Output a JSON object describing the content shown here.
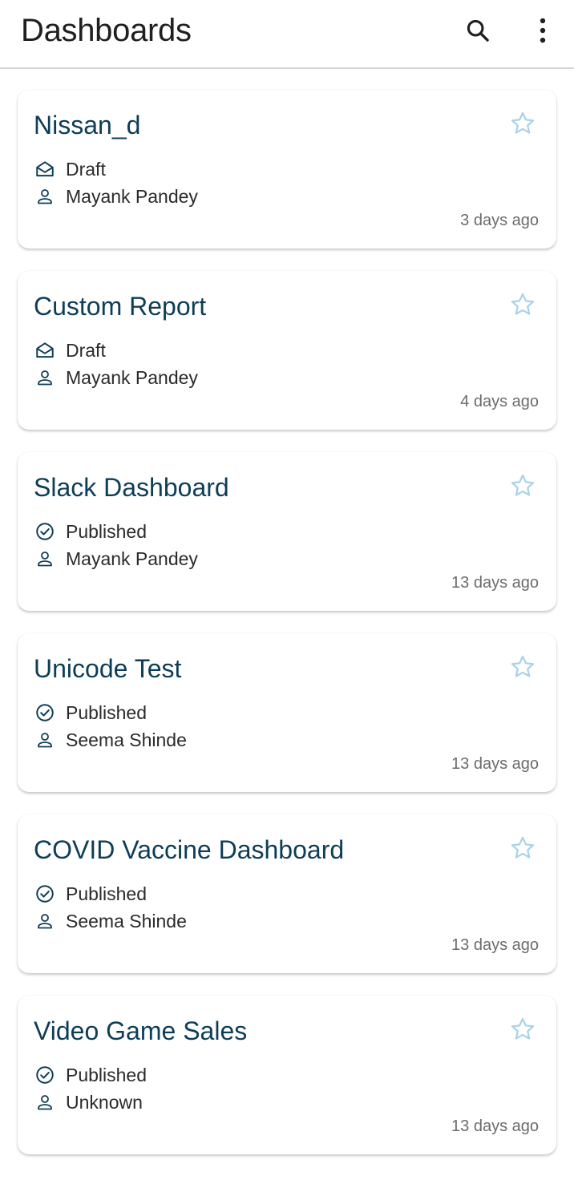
{
  "app_bar": {
    "title": "Dashboards",
    "search_icon": "search-icon",
    "more_icon": "more-vertical-icon"
  },
  "colors": {
    "title_text": "#0e3d57",
    "star_outline": "#a9d3ea",
    "meta_icon": "#0e3d57"
  },
  "dashboards": [
    {
      "title": "Nissan_d",
      "status": "Draft",
      "status_icon": "draft-envelope-icon",
      "owner": "Mayank Pandey",
      "updated": "3 days ago",
      "starred": false
    },
    {
      "title": "Custom Report",
      "status": "Draft",
      "status_icon": "draft-envelope-icon",
      "owner": "Mayank Pandey",
      "updated": "4 days ago",
      "starred": false
    },
    {
      "title": "Slack Dashboard",
      "status": "Published",
      "status_icon": "check-circle-icon",
      "owner": "Mayank Pandey",
      "updated": "13 days ago",
      "starred": false
    },
    {
      "title": "Unicode Test",
      "status": "Published",
      "status_icon": "check-circle-icon",
      "owner": "Seema Shinde",
      "updated": "13 days ago",
      "starred": false
    },
    {
      "title": "COVID Vaccine Dashboard",
      "status": "Published",
      "status_icon": "check-circle-icon",
      "owner": "Seema Shinde",
      "updated": "13 days ago",
      "starred": false
    },
    {
      "title": "Video Game Sales",
      "status": "Published",
      "status_icon": "check-circle-icon",
      "owner": "Unknown",
      "updated": "13 days ago",
      "starred": false
    }
  ]
}
